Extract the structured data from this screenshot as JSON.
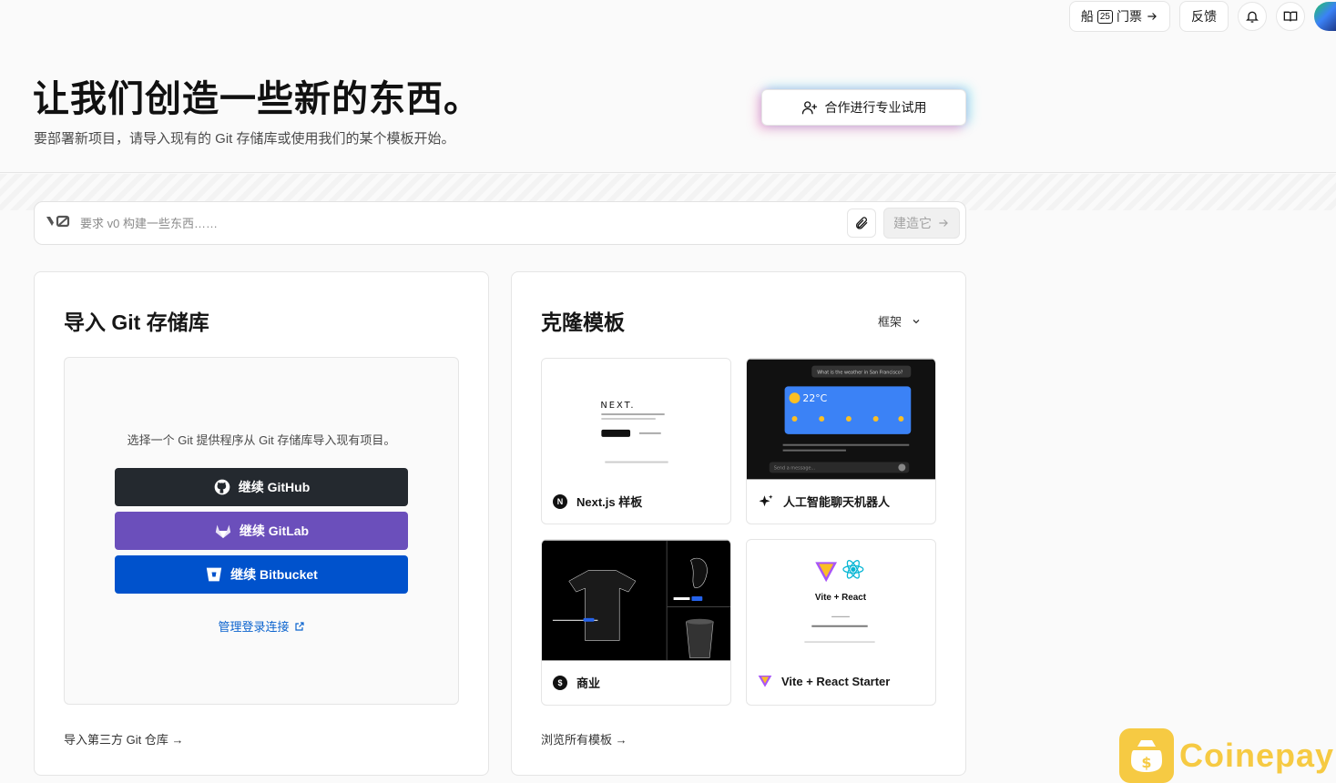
{
  "topbar": {
    "ship_label": "船",
    "ship_badge": "25",
    "ship_suffix": "门票",
    "feedback": "反馈"
  },
  "header": {
    "title": "让我们创造一些新的东西。",
    "subtitle": "要部署新项目，请导入现有的 Git 存储库或使用我们的某个模板开始。",
    "collab_button": "合作进行专业试用"
  },
  "prompt": {
    "logo": "v0",
    "placeholder": "要求 v0 构建一些东西……",
    "build_button": "建造它"
  },
  "import": {
    "title": "导入 Git 存储库",
    "description": "选择一个 Git 提供程序从 Git 存储库导入现有项目。",
    "github": "继续 GitHub",
    "gitlab": "继续 GitLab",
    "bitbucket": "继续 Bitbucket",
    "manage_link": "管理登录连接",
    "third_party": "导入第三方 Git 仓库 →"
  },
  "clone": {
    "title": "克隆模板",
    "framework": "框架",
    "templates": [
      {
        "label": "Next.js 样板"
      },
      {
        "label": "人工智能聊天机器人",
        "weather_prompt": "What is the weather in San Francisco?",
        "temp": "22°C",
        "input_placeholder": "Send a message..."
      },
      {
        "label": "商业"
      },
      {
        "label": "Vite + React Starter",
        "preview_title": "Vite + React"
      }
    ],
    "browse": "浏览所有模板 →"
  },
  "watermark": {
    "text": "Coinepay"
  },
  "colors": {
    "github": "#24292f",
    "gitlab": "#6b4fbb",
    "bitbucket": "#0052cc",
    "link": "#0b63ce"
  }
}
